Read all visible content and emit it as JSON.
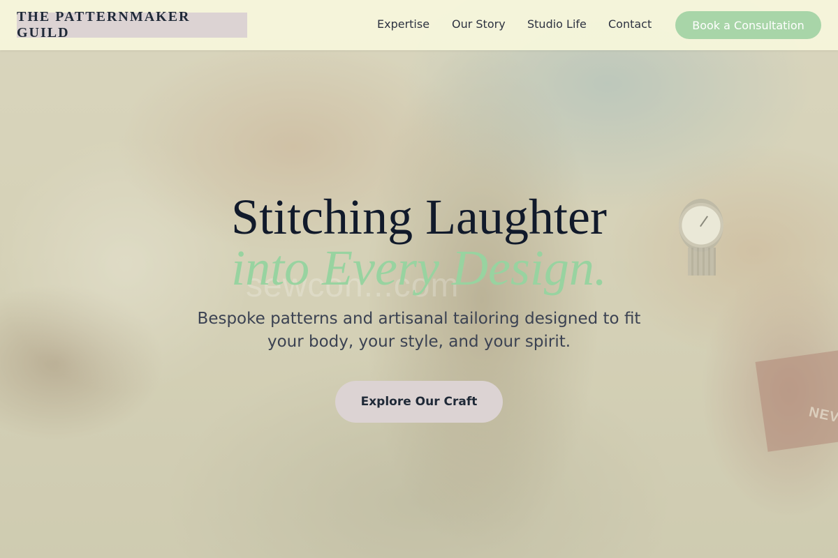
{
  "header": {
    "logo_text": "THE PATTERNMAKER GUILD",
    "nav": [
      {
        "label": "Expertise"
      },
      {
        "label": "Our Story"
      },
      {
        "label": "Studio Life"
      },
      {
        "label": "Contact"
      }
    ],
    "cta_label": "Book a Consultation"
  },
  "hero": {
    "title_line1": "Stitching Laughter",
    "title_line2": "into Every Design.",
    "subtitle": "Bespoke patterns and artisanal tailoring designed to fit your body, your style, and your spirit.",
    "button_label": "Explore Our Craft",
    "watermark_text": "sewcon...com",
    "box_label": "NEV"
  },
  "colors": {
    "header_bg": "#f6f6dc",
    "logo_bg": "#dcd3d3",
    "cta_bg": "#a8d5a8",
    "title_dark": "#111a2b",
    "title_accent": "#98d3a0",
    "hero_button_bg": "#dcd3d3"
  },
  "icons": [
    "wristwatch-image",
    "watermark"
  ]
}
